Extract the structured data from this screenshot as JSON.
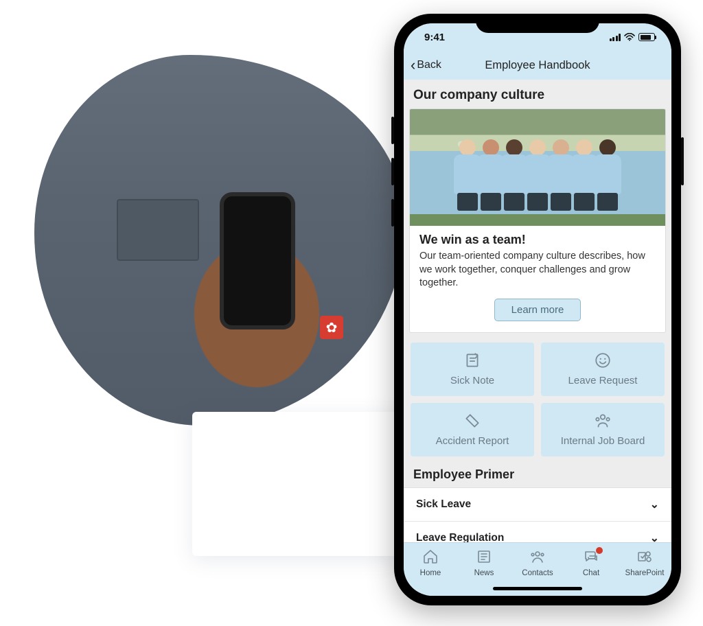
{
  "statusbar": {
    "time": "9:41"
  },
  "nav": {
    "back_label": "Back",
    "title": "Employee Handbook"
  },
  "section_title": "Our company culture",
  "culture_card": {
    "title": "We win as a team!",
    "text": "Our team-oriented company culture describes, how we work together, conquer challenges and grow together.",
    "button_label": "Learn more"
  },
  "tiles": [
    {
      "label": "Sick Note",
      "icon": "note-icon"
    },
    {
      "label": "Leave Request",
      "icon": "smile-icon"
    },
    {
      "label": "Accident Report",
      "icon": "ticket-icon"
    },
    {
      "label": "Internal Job Board",
      "icon": "group-icon"
    }
  ],
  "primer": {
    "title": "Employee Primer",
    "items": [
      {
        "label": "Sick Leave"
      },
      {
        "label": "Leave Regulation"
      }
    ]
  },
  "tabs": [
    {
      "label": "Home",
      "icon": "home-icon",
      "badge": false
    },
    {
      "label": "News",
      "icon": "news-icon",
      "badge": false
    },
    {
      "label": "Contacts",
      "icon": "contacts-icon",
      "badge": false
    },
    {
      "label": "Chat",
      "icon": "chat-icon",
      "badge": true
    },
    {
      "label": "SharePoint",
      "icon": "sharepoint-icon",
      "badge": false
    }
  ],
  "people_skin": [
    "#e8c9a8",
    "#c89070",
    "#5a4030",
    "#e8c9a8",
    "#d9b090",
    "#e8c9a8",
    "#4a3628"
  ]
}
